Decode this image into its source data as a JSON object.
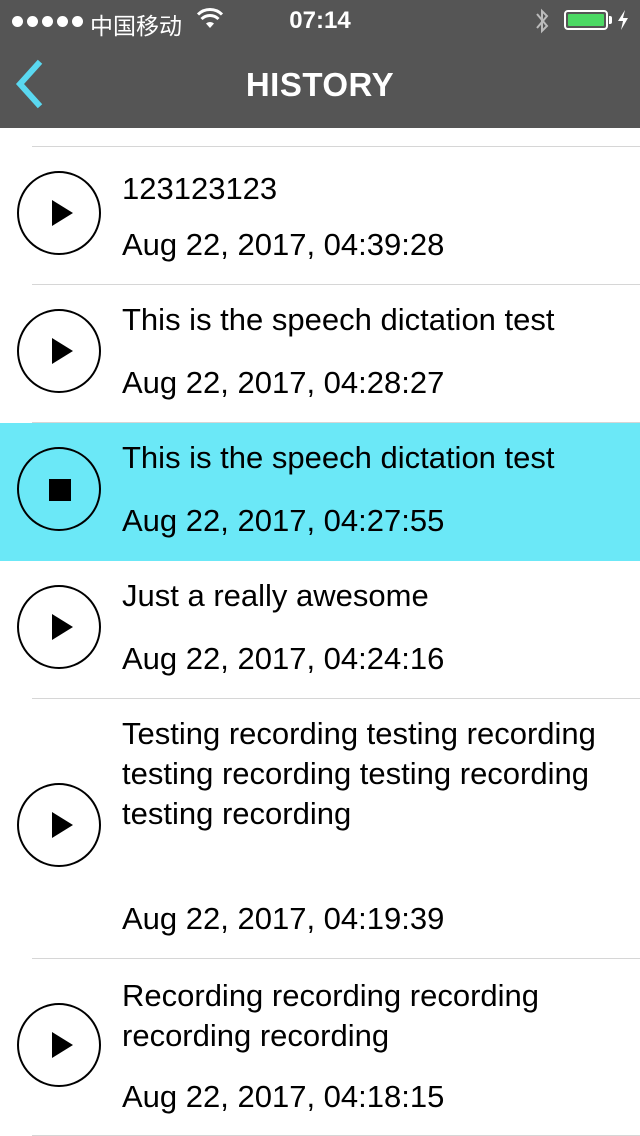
{
  "status_bar": {
    "carrier": "中国移动",
    "time": "07:14",
    "battery_color": "#4cd964"
  },
  "nav": {
    "title": "HISTORY",
    "back_icon": "chevron-left-icon",
    "accent_color": "#5ad8f0"
  },
  "history": [
    {
      "title": "123123123",
      "date": "Aug 22, 2017, 04:39:28",
      "state": "play"
    },
    {
      "title": "This is the speech dictation test",
      "date": "Aug 22, 2017, 04:28:27",
      "state": "play"
    },
    {
      "title": "This is the speech dictation test",
      "date": "Aug 22, 2017, 04:27:55",
      "state": "stop",
      "selected": true
    },
    {
      "title": "Just a really awesome",
      "date": "Aug 22, 2017, 04:24:16",
      "state": "play"
    },
    {
      "title": "Testing recording testing recording testing recording testing recording testing recording",
      "date": "Aug 22, 2017, 04:19:39",
      "state": "play"
    },
    {
      "title": "Recording recording recording recording recording",
      "date": "Aug 22, 2017, 04:18:15",
      "state": "play"
    }
  ],
  "selected_color": "#6be8f7"
}
